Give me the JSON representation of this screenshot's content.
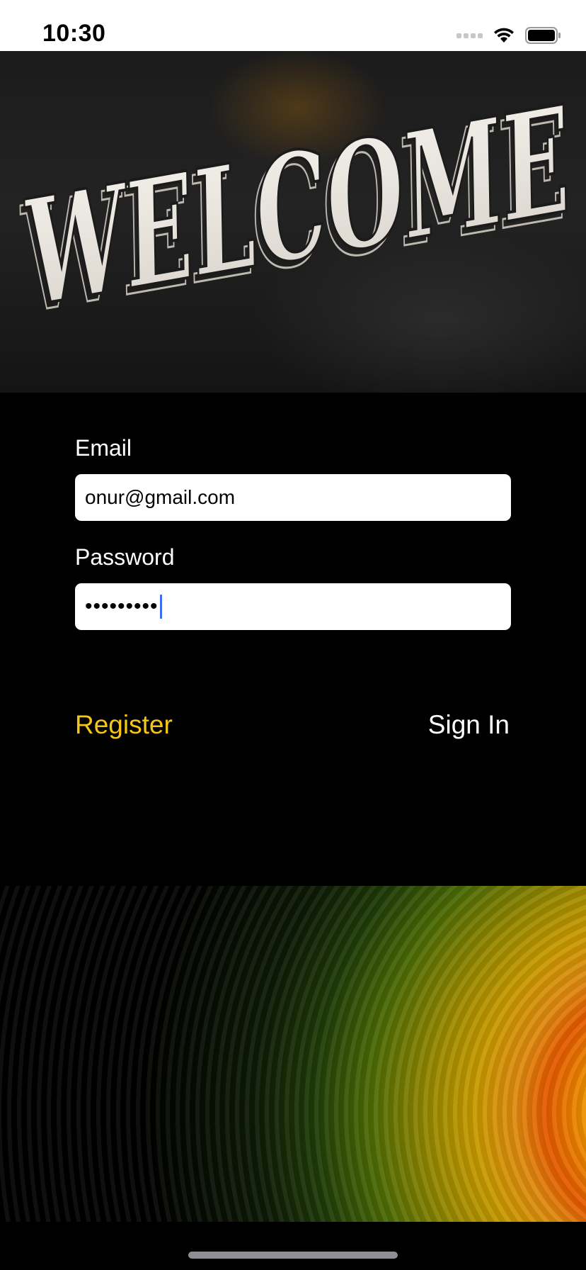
{
  "status_bar": {
    "time": "10:30",
    "icons": [
      "signal-icon",
      "wifi-icon",
      "battery-icon"
    ]
  },
  "banner": {
    "text": "WELCOME"
  },
  "form": {
    "email": {
      "label": "Email",
      "value": "onur@gmail.com"
    },
    "password": {
      "label": "Password",
      "masked_value": "•••••••••"
    }
  },
  "actions": {
    "register_label": "Register",
    "signin_label": "Sign In"
  },
  "colors": {
    "background": "#000000",
    "accent": "#f5c518",
    "caret": "#3d6ef2"
  }
}
